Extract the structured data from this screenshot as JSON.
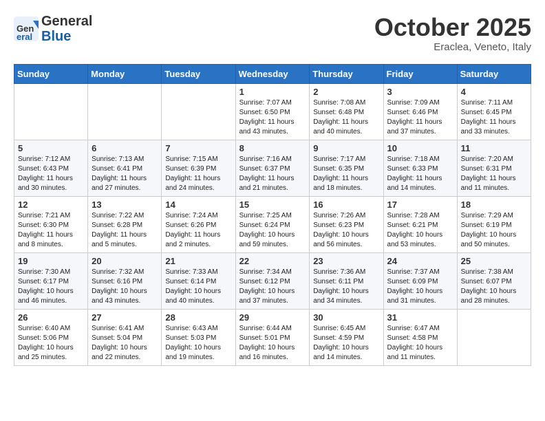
{
  "header": {
    "logo_general": "General",
    "logo_blue": "Blue",
    "month_title": "October 2025",
    "location": "Eraclea, Veneto, Italy"
  },
  "days_of_week": [
    "Sunday",
    "Monday",
    "Tuesday",
    "Wednesday",
    "Thursday",
    "Friday",
    "Saturday"
  ],
  "weeks": [
    {
      "cells": [
        {
          "empty": true
        },
        {
          "empty": true
        },
        {
          "empty": true
        },
        {
          "day": "1",
          "sunrise": "Sunrise: 7:07 AM",
          "sunset": "Sunset: 6:50 PM",
          "daylight": "Daylight: 11 hours and 43 minutes."
        },
        {
          "day": "2",
          "sunrise": "Sunrise: 7:08 AM",
          "sunset": "Sunset: 6:48 PM",
          "daylight": "Daylight: 11 hours and 40 minutes."
        },
        {
          "day": "3",
          "sunrise": "Sunrise: 7:09 AM",
          "sunset": "Sunset: 6:46 PM",
          "daylight": "Daylight: 11 hours and 37 minutes."
        },
        {
          "day": "4",
          "sunrise": "Sunrise: 7:11 AM",
          "sunset": "Sunset: 6:45 PM",
          "daylight": "Daylight: 11 hours and 33 minutes."
        }
      ]
    },
    {
      "cells": [
        {
          "day": "5",
          "sunrise": "Sunrise: 7:12 AM",
          "sunset": "Sunset: 6:43 PM",
          "daylight": "Daylight: 11 hours and 30 minutes."
        },
        {
          "day": "6",
          "sunrise": "Sunrise: 7:13 AM",
          "sunset": "Sunset: 6:41 PM",
          "daylight": "Daylight: 11 hours and 27 minutes."
        },
        {
          "day": "7",
          "sunrise": "Sunrise: 7:15 AM",
          "sunset": "Sunset: 6:39 PM",
          "daylight": "Daylight: 11 hours and 24 minutes."
        },
        {
          "day": "8",
          "sunrise": "Sunrise: 7:16 AM",
          "sunset": "Sunset: 6:37 PM",
          "daylight": "Daylight: 11 hours and 21 minutes."
        },
        {
          "day": "9",
          "sunrise": "Sunrise: 7:17 AM",
          "sunset": "Sunset: 6:35 PM",
          "daylight": "Daylight: 11 hours and 18 minutes."
        },
        {
          "day": "10",
          "sunrise": "Sunrise: 7:18 AM",
          "sunset": "Sunset: 6:33 PM",
          "daylight": "Daylight: 11 hours and 14 minutes."
        },
        {
          "day": "11",
          "sunrise": "Sunrise: 7:20 AM",
          "sunset": "Sunset: 6:31 PM",
          "daylight": "Daylight: 11 hours and 11 minutes."
        }
      ]
    },
    {
      "cells": [
        {
          "day": "12",
          "sunrise": "Sunrise: 7:21 AM",
          "sunset": "Sunset: 6:30 PM",
          "daylight": "Daylight: 11 hours and 8 minutes."
        },
        {
          "day": "13",
          "sunrise": "Sunrise: 7:22 AM",
          "sunset": "Sunset: 6:28 PM",
          "daylight": "Daylight: 11 hours and 5 minutes."
        },
        {
          "day": "14",
          "sunrise": "Sunrise: 7:24 AM",
          "sunset": "Sunset: 6:26 PM",
          "daylight": "Daylight: 11 hours and 2 minutes."
        },
        {
          "day": "15",
          "sunrise": "Sunrise: 7:25 AM",
          "sunset": "Sunset: 6:24 PM",
          "daylight": "Daylight: 10 hours and 59 minutes."
        },
        {
          "day": "16",
          "sunrise": "Sunrise: 7:26 AM",
          "sunset": "Sunset: 6:23 PM",
          "daylight": "Daylight: 10 hours and 56 minutes."
        },
        {
          "day": "17",
          "sunrise": "Sunrise: 7:28 AM",
          "sunset": "Sunset: 6:21 PM",
          "daylight": "Daylight: 10 hours and 53 minutes."
        },
        {
          "day": "18",
          "sunrise": "Sunrise: 7:29 AM",
          "sunset": "Sunset: 6:19 PM",
          "daylight": "Daylight: 10 hours and 50 minutes."
        }
      ]
    },
    {
      "cells": [
        {
          "day": "19",
          "sunrise": "Sunrise: 7:30 AM",
          "sunset": "Sunset: 6:17 PM",
          "daylight": "Daylight: 10 hours and 46 minutes."
        },
        {
          "day": "20",
          "sunrise": "Sunrise: 7:32 AM",
          "sunset": "Sunset: 6:16 PM",
          "daylight": "Daylight: 10 hours and 43 minutes."
        },
        {
          "day": "21",
          "sunrise": "Sunrise: 7:33 AM",
          "sunset": "Sunset: 6:14 PM",
          "daylight": "Daylight: 10 hours and 40 minutes."
        },
        {
          "day": "22",
          "sunrise": "Sunrise: 7:34 AM",
          "sunset": "Sunset: 6:12 PM",
          "daylight": "Daylight: 10 hours and 37 minutes."
        },
        {
          "day": "23",
          "sunrise": "Sunrise: 7:36 AM",
          "sunset": "Sunset: 6:11 PM",
          "daylight": "Daylight: 10 hours and 34 minutes."
        },
        {
          "day": "24",
          "sunrise": "Sunrise: 7:37 AM",
          "sunset": "Sunset: 6:09 PM",
          "daylight": "Daylight: 10 hours and 31 minutes."
        },
        {
          "day": "25",
          "sunrise": "Sunrise: 7:38 AM",
          "sunset": "Sunset: 6:07 PM",
          "daylight": "Daylight: 10 hours and 28 minutes."
        }
      ]
    },
    {
      "cells": [
        {
          "day": "26",
          "sunrise": "Sunrise: 6:40 AM",
          "sunset": "Sunset: 5:06 PM",
          "daylight": "Daylight: 10 hours and 25 minutes."
        },
        {
          "day": "27",
          "sunrise": "Sunrise: 6:41 AM",
          "sunset": "Sunset: 5:04 PM",
          "daylight": "Daylight: 10 hours and 22 minutes."
        },
        {
          "day": "28",
          "sunrise": "Sunrise: 6:43 AM",
          "sunset": "Sunset: 5:03 PM",
          "daylight": "Daylight: 10 hours and 19 minutes."
        },
        {
          "day": "29",
          "sunrise": "Sunrise: 6:44 AM",
          "sunset": "Sunset: 5:01 PM",
          "daylight": "Daylight: 10 hours and 16 minutes."
        },
        {
          "day": "30",
          "sunrise": "Sunrise: 6:45 AM",
          "sunset": "Sunset: 4:59 PM",
          "daylight": "Daylight: 10 hours and 14 minutes."
        },
        {
          "day": "31",
          "sunrise": "Sunrise: 6:47 AM",
          "sunset": "Sunset: 4:58 PM",
          "daylight": "Daylight: 10 hours and 11 minutes."
        },
        {
          "empty": true
        }
      ]
    }
  ]
}
